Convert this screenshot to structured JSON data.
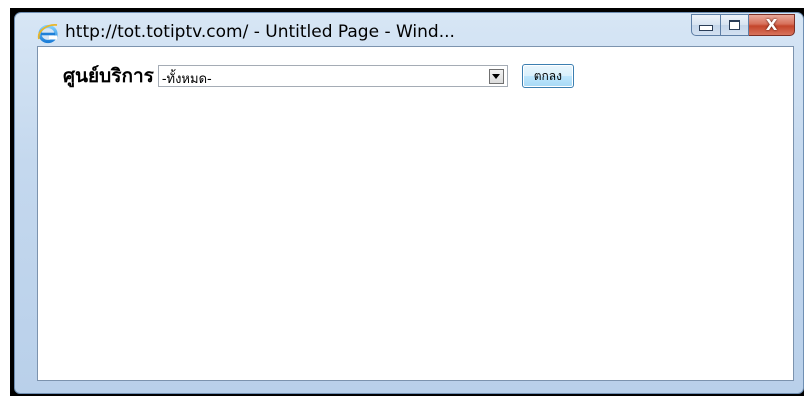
{
  "window": {
    "title": "http://tot.totiptv.com/ - Untitled Page - Wind...",
    "icon": "internet-explorer-icon",
    "controls": {
      "minimize_icon": "minimize-icon",
      "maximize_icon": "maximize-icon",
      "close_icon": "close-icon",
      "close_glyph": "X"
    }
  },
  "form": {
    "service_center_label": "ศูนย์บริการ",
    "service_center_select": {
      "selected": "-ทั้งหมด-"
    },
    "submit_label": "ตกลง"
  },
  "colors": {
    "frame": "#c4d8ee",
    "close_button": "#c4452b",
    "ok_button": "#bee6fd",
    "ie_icon": "#1e7fd8"
  }
}
